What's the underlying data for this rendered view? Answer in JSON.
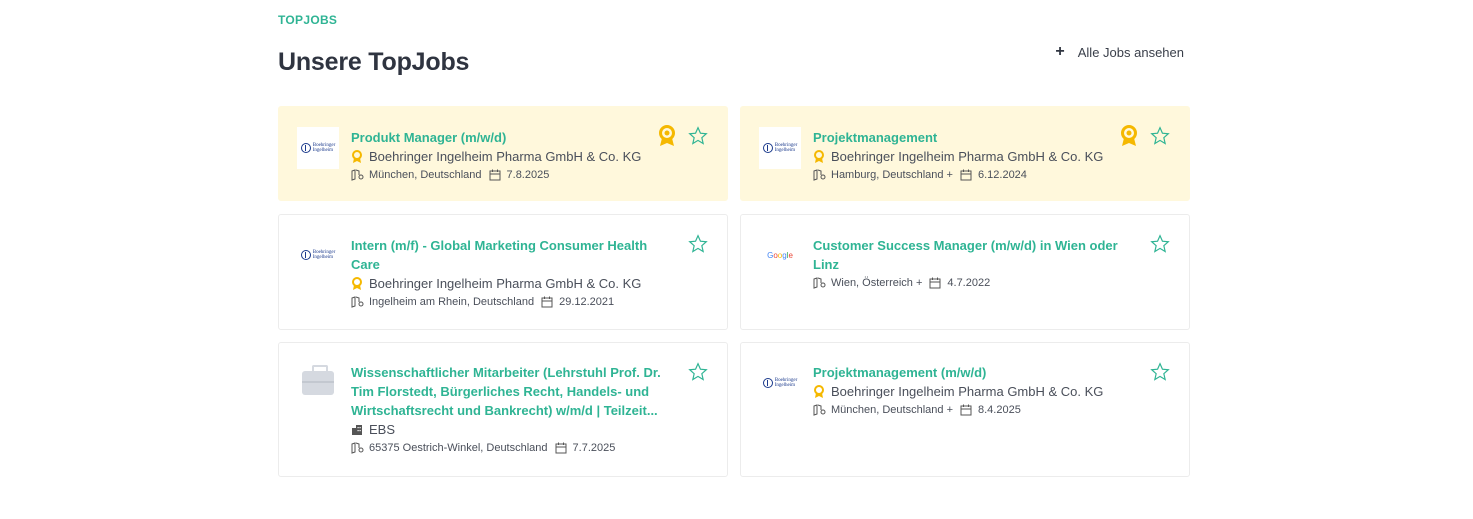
{
  "header": {
    "eyebrow": "TOPJOBS",
    "title": "Unsere TopJobs",
    "all_jobs_label": "Alle Jobs ansehen"
  },
  "colors": {
    "accent": "#2fb494",
    "featured_bg": "#fff8dc",
    "badge": "#f5b800"
  },
  "jobs": [
    {
      "title": "Produkt Manager (m/w/d)",
      "company": "Boehringer Ingelheim Pharma GmbH & Co. KG",
      "location": "München, Deutschland",
      "date": "7.8.2025",
      "logo": "boehringer-logo",
      "logo_text_1": "Boehringer",
      "logo_text_2": "Ingelheim",
      "featured": true
    },
    {
      "title": "Projektmanagement",
      "company": "Boehringer Ingelheim Pharma GmbH & Co. KG",
      "location": "Hamburg, Deutschland +",
      "date": "6.12.2024",
      "logo": "boehringer-logo",
      "logo_text_1": "Boehringer",
      "logo_text_2": "Ingelheim",
      "featured": true
    },
    {
      "title": "Intern (m/f) - Global Marketing Consumer Health Care",
      "company": "Boehringer Ingelheim Pharma GmbH & Co. KG",
      "location": "Ingelheim am Rhein, Deutschland",
      "date": "29.12.2021",
      "logo": "boehringer-logo",
      "logo_text_1": "Boehringer",
      "logo_text_2": "Ingelheim",
      "featured": false
    },
    {
      "title": "Customer Success Manager (m/w/d) in Wien oder Linz",
      "company": "",
      "location": "Wien, Österreich +",
      "date": "4.7.2022",
      "logo": "google-logo",
      "featured": false
    },
    {
      "title": "Wissenschaftlicher Mitarbeiter (Lehrstuhl Prof. Dr. Tim Florstedt, Bürgerliches Recht, Handels- und Wirtschaftsrecht und Bankrecht) w/m/d | Teilzeit...",
      "company": "EBS",
      "location": "65375 Oestrich-Winkel, Deutschland",
      "date": "7.7.2025",
      "logo": "briefcase-placeholder-icon",
      "featured": false
    },
    {
      "title": "Projektmanagement (m/w/d)",
      "company": "Boehringer Ingelheim Pharma GmbH & Co. KG",
      "location": "München, Deutschland +",
      "date": "8.4.2025",
      "logo": "boehringer-logo",
      "logo_text_1": "Boehringer",
      "logo_text_2": "Ingelheim",
      "featured": false
    }
  ]
}
